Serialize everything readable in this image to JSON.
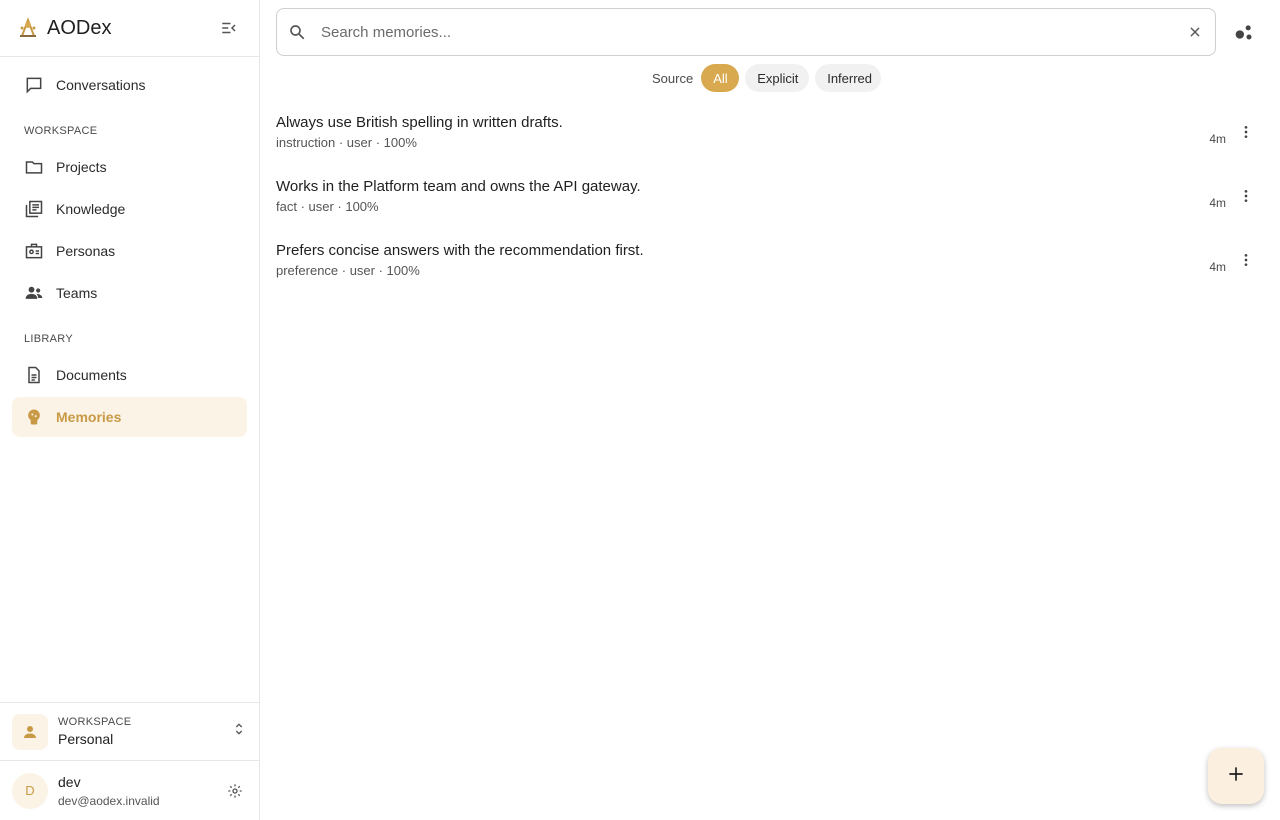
{
  "app": {
    "name": "AODex"
  },
  "sidebar": {
    "top_items": [
      {
        "label": "Conversations",
        "icon": "chat-bubble-icon"
      }
    ],
    "workspace_section": {
      "label": "WORKSPACE",
      "items": [
        {
          "label": "Projects",
          "icon": "folder-icon"
        },
        {
          "label": "Knowledge",
          "icon": "library-books-icon"
        },
        {
          "label": "Personas",
          "icon": "badge-icon"
        },
        {
          "label": "Teams",
          "icon": "group-icon"
        }
      ]
    },
    "library_section": {
      "label": "LIBRARY",
      "items": [
        {
          "label": "Documents",
          "icon": "document-icon"
        },
        {
          "label": "Memories",
          "icon": "brain-icon",
          "active": true
        }
      ]
    },
    "workspace_switcher": {
      "label": "WORKSPACE",
      "name": "Personal"
    },
    "user": {
      "initial": "D",
      "name": "dev",
      "email": "dev@aodex.invalid"
    }
  },
  "search": {
    "placeholder": "Search memories...",
    "value": ""
  },
  "filters": {
    "label": "Source",
    "chips": [
      {
        "label": "All",
        "selected": true
      },
      {
        "label": "Explicit",
        "selected": false
      },
      {
        "label": "Inferred",
        "selected": false
      }
    ]
  },
  "memories": [
    {
      "title": "Always use British spelling in written drafts.",
      "meta": "instruction · user · 100%",
      "time": "4m"
    },
    {
      "title": "Works in the Platform team and owns the API gateway.",
      "meta": "fact · user · 100%",
      "time": "4m"
    },
    {
      "title": "Prefers concise answers with the recommendation first.",
      "meta": "preference · user · 100%",
      "time": "4m"
    }
  ],
  "colors": {
    "accent": "#d9a94f",
    "accent_soft": "#fbf3e6",
    "accent_text": "#c89a45"
  }
}
